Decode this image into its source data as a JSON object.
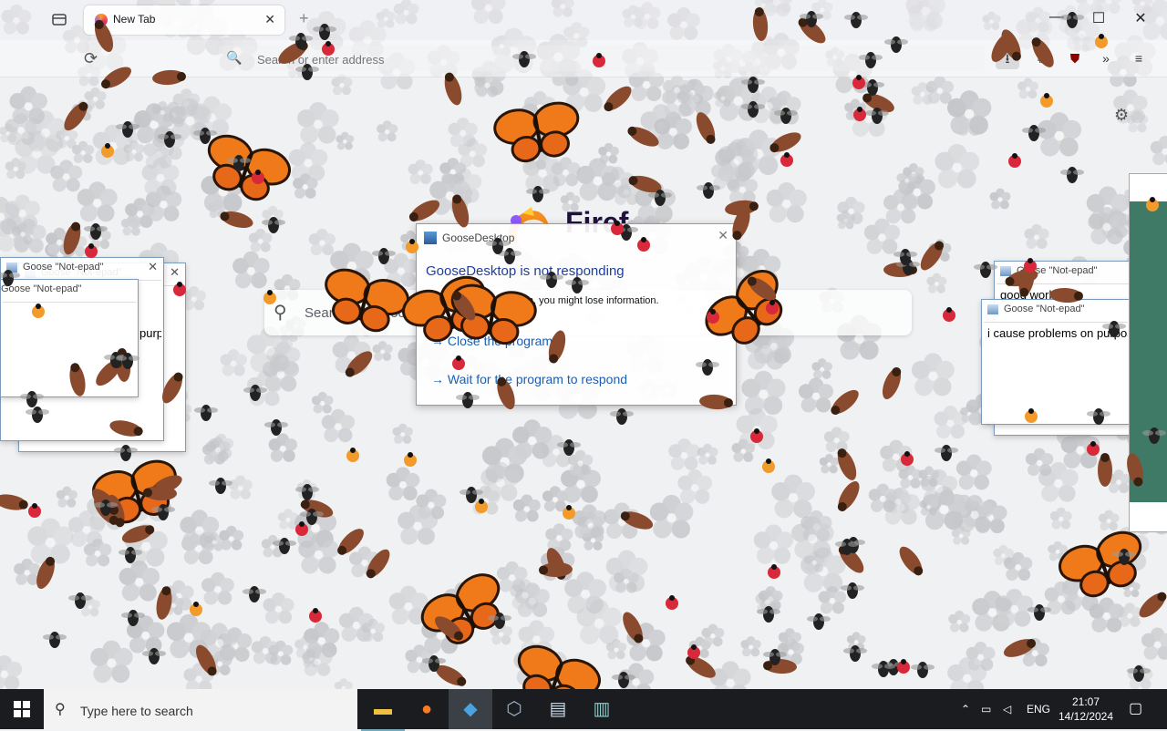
{
  "browser": {
    "tab_title": "New Tab",
    "url_placeholder": "Search or enter address",
    "new_tab_symbol": "+",
    "brand_word": "Firef",
    "search_placeholder": "Search with Google or enter address"
  },
  "dialog": {
    "title": "GooseDesktop",
    "heading": "GooseDesktop is not responding",
    "message": "If you close the program, you might lose information.",
    "option_close": "Close the program",
    "option_wait": "Wait for the program to respond"
  },
  "notepads": {
    "left_front_title": "Goose \"Not-epad\"",
    "left_back_title": "Goose \"Not-epad\"",
    "left_text": "purpose",
    "right_back_title": "Goose \"Not-epad\"",
    "right_back_text": "good work",
    "right_front_title": "Goose \"Not-epad\"",
    "right_front_text": "i cause problems on purpose"
  },
  "taskbar": {
    "search_placeholder": "Type here to search",
    "language": "ENG",
    "time": "21:07",
    "date": "14/12/2024"
  },
  "colors": {
    "accent_blue": "#1a5fb4",
    "butterfly_orange": "#f07a1a",
    "taskbar": "#1a1c20"
  }
}
